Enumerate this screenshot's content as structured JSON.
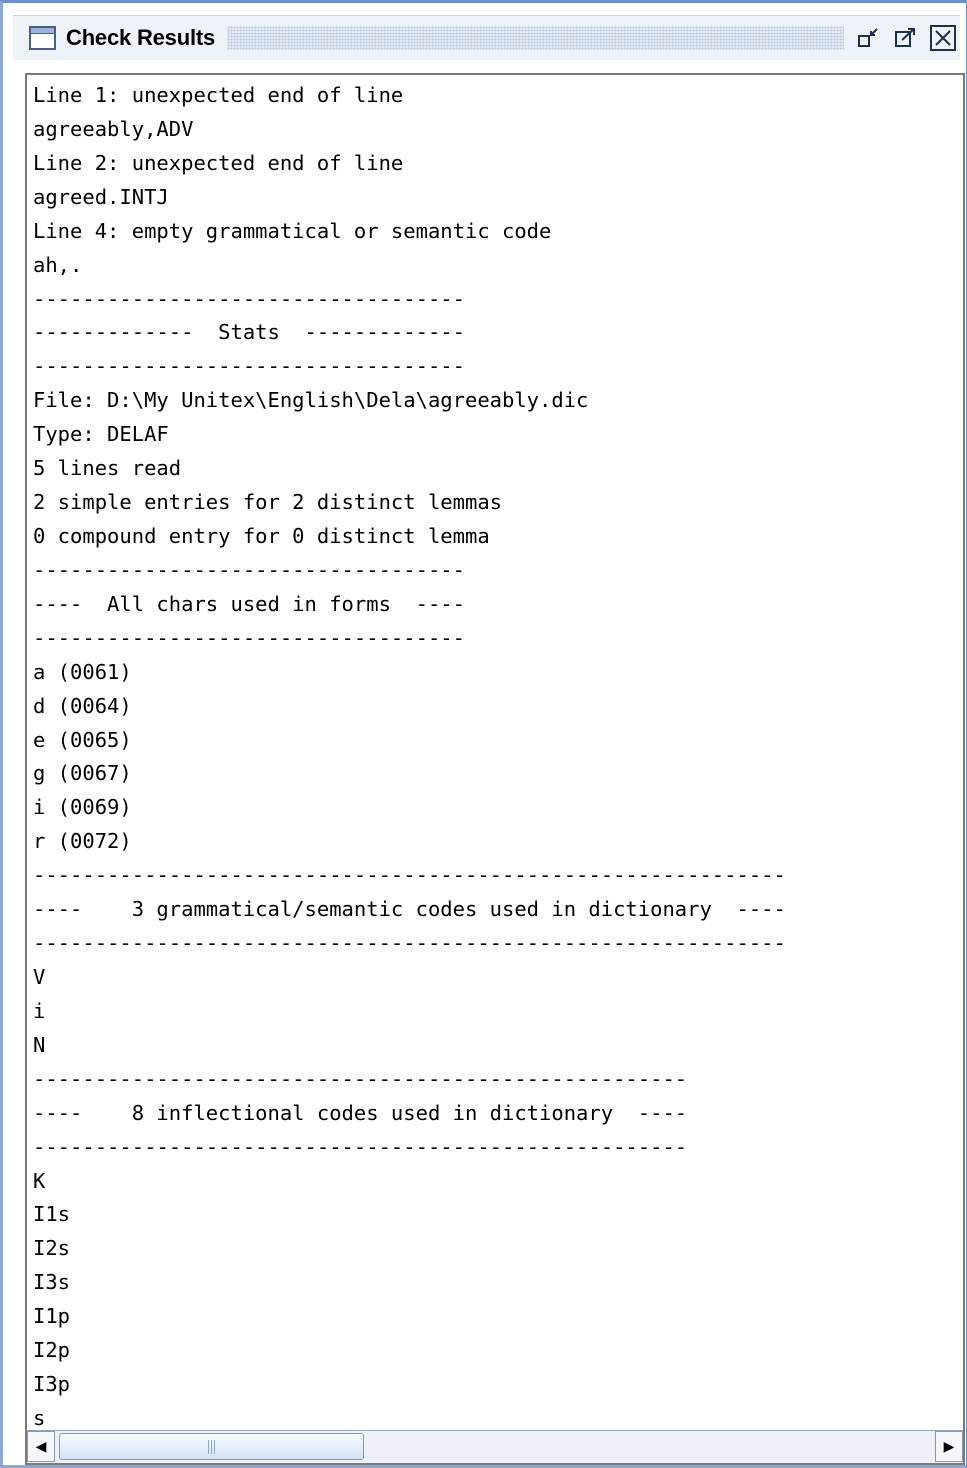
{
  "window": {
    "title": "Check Results",
    "controls": [
      "minimize-icon",
      "maximize-icon",
      "close-icon"
    ]
  },
  "content": {
    "lines": [
      "Line 1: unexpected end of line",
      "agreeably,ADV",
      "Line 2: unexpected end of line",
      "agreed.INTJ",
      "Line 4: empty grammatical or semantic code",
      "ah,.",
      "-----------------------------------",
      "-------------  Stats  -------------",
      "-----------------------------------",
      "File: D:\\My Unitex\\English\\Dela\\agreeably.dic",
      "Type: DELAF",
      "5 lines read",
      "2 simple entries for 2 distinct lemmas",
      "0 compound entry for 0 distinct lemma",
      "-----------------------------------",
      "----  All chars used in forms  ----",
      "-----------------------------------",
      "a (0061)",
      "d (0064)",
      "e (0065)",
      "g (0067)",
      "i (0069)",
      "r (0072)",
      "-------------------------------------------------------------",
      "----    3 grammatical/semantic codes used in dictionary  ----",
      "-------------------------------------------------------------",
      "V",
      "i",
      "N",
      "-----------------------------------------------------",
      "----    8 inflectional codes used in dictionary  ----",
      "-----------------------------------------------------",
      "K",
      "I1s",
      "I2s",
      "I3s",
      "I1p",
      "I2p",
      "I3p",
      "s"
    ]
  },
  "scrollbar": {
    "left_arrow": "◀",
    "right_arrow": "▶"
  }
}
